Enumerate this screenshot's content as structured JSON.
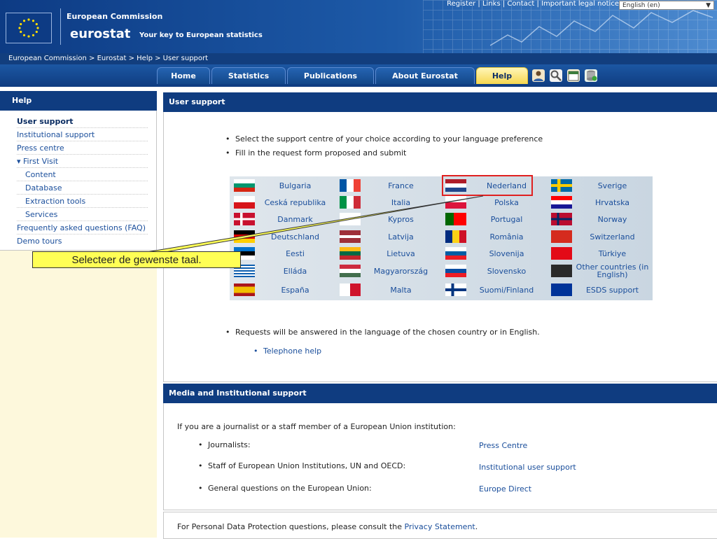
{
  "header": {
    "commission_name": "European Commission",
    "logo_text": "eurostat",
    "tagline": "Your key to European statistics",
    "top_links": [
      "Register",
      "Links",
      "Contact",
      "Important legal notice"
    ],
    "language_select": "English (en)"
  },
  "breadcrumb": "European Commission > Eurostat > Help  > User support",
  "nav": {
    "tabs": [
      "Home",
      "Statistics",
      "Publications",
      "About Eurostat",
      "Help"
    ],
    "active": "Help",
    "tool_icons": [
      "user-icon",
      "search-icon",
      "calendar-icon",
      "database-icon"
    ]
  },
  "sidebar": {
    "title": "Help",
    "items": [
      {
        "label": "User support"
      },
      {
        "label": "Institutional support"
      },
      {
        "label": "Press centre"
      },
      {
        "label": "▾ First Visit"
      },
      {
        "label": "Content"
      },
      {
        "label": "Database"
      },
      {
        "label": "Extraction tools"
      },
      {
        "label": "Services"
      },
      {
        "label": "Frequently asked questions (FAQ)"
      },
      {
        "label": "Demo tours"
      }
    ]
  },
  "user_support": {
    "title": "User support",
    "instructions": [
      "Select the support centre of your choice according to your language preference",
      "Fill in the request form proposed and submit"
    ],
    "countries": [
      [
        "Bulgaria",
        "France",
        "Nederland",
        "Sverige"
      ],
      [
        "Ceská republika",
        "Italia",
        "Polska",
        "Hrvatska"
      ],
      [
        "Danmark",
        "Kypros",
        "Portugal",
        "Norway"
      ],
      [
        "Deutschland",
        "Latvija",
        "România",
        "Switzerland"
      ],
      [
        "Eesti",
        "Lietuva",
        "Slovenija",
        "Türkiye"
      ],
      [
        "Elláda",
        "Magyarország",
        "Slovensko",
        "Other countries (in English)"
      ],
      [
        "España",
        "Malta",
        "Suomi/Finland",
        "ESDS support"
      ]
    ],
    "answer_note": "Requests will be answered in the language of the chosen country or in English.",
    "telephone_link": "Telephone help"
  },
  "callout": "Selecteer de gewenste taal.",
  "media": {
    "title": "Media and Institutional support",
    "intro": "If you are a journalist or a staff member of a European Union institution:",
    "rows": [
      {
        "label": "Journalists:",
        "link": "Press Centre"
      },
      {
        "label": "Staff of European Union Institutions, UN and OECD:",
        "link": "Institutional user support"
      },
      {
        "label": "General questions on the European Union:",
        "link": "Europe Direct"
      }
    ]
  },
  "footer": {
    "text": "For Personal Data Protection questions, please consult the",
    "link": "Privacy Statement",
    "end": "."
  },
  "colors": {
    "header_blue": "#0f3c80",
    "link_blue": "#1a4e9b",
    "active_tab": "#f6d750",
    "callout_yellow": "#ffff55",
    "highlight_red": "#e02020"
  }
}
